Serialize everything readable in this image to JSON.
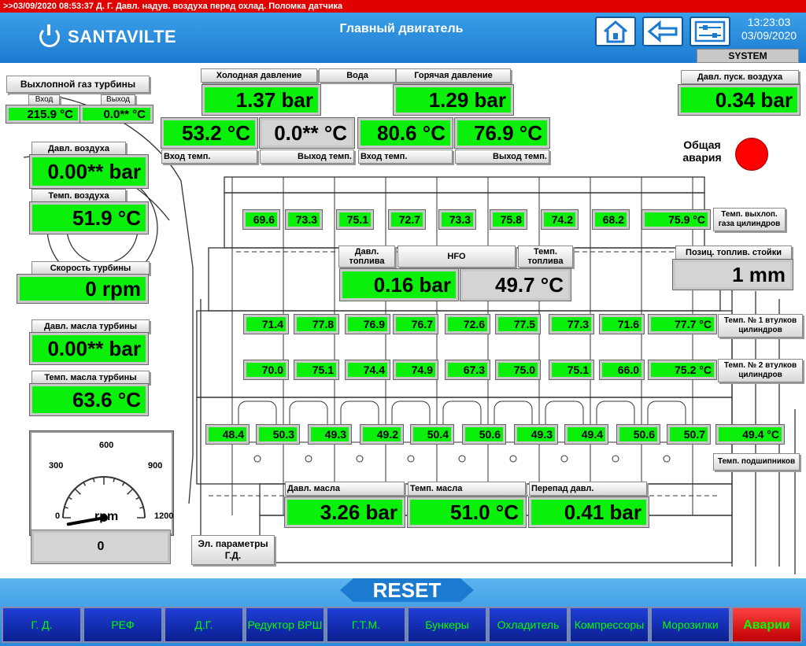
{
  "alarm_banner": ">>03/09/2020 08:53:37 Д. Г. Давл. надув. воздуха перед охлад. Поломка датчика",
  "header": {
    "logo": "SANTAVILTE",
    "title": "Главный двигатель",
    "time": "13:23:03",
    "date": "03/09/2020",
    "system_label": "SYSTEM"
  },
  "turbo_exhaust": {
    "title": "Выхлопной газ турбины",
    "in_label": "Вход",
    "out_label": "Выход",
    "in_value": "215.9 °C",
    "out_value": "0.0** °C"
  },
  "air_pressure": {
    "label": "Давл. воздуха",
    "value": "0.00** bar"
  },
  "air_temp": {
    "label": "Темп. воздуха",
    "value": "51.9 °C"
  },
  "turbo_speed": {
    "label": "Скорость турбины",
    "value": "0 rpm"
  },
  "turbo_oil_pressure": {
    "label": "Давл. масла турбины",
    "value": "0.00** bar"
  },
  "turbo_oil_temp": {
    "label": "Темп. масла турбины",
    "value": "63.6 °C"
  },
  "water": {
    "cold_label": "Холодная давление",
    "water_label": "Вода",
    "hot_label": "Горячая давление",
    "cold_pressure": "1.37 bar",
    "hot_pressure": "1.29 bar",
    "cold_in_temp": "53.2 °C",
    "cold_out_temp": "0.0** °C",
    "hot_in_temp": "80.6 °C",
    "hot_out_temp": "76.9 °C",
    "in_label": "Вход темп.",
    "out_label": "Выход темп."
  },
  "start_air": {
    "label": "Давл. пуск. воздуха",
    "value": "0.34 bar"
  },
  "general_alarm": {
    "label": "Общая авария",
    "color": "#ff0000"
  },
  "exhaust_cyl": {
    "label": "Темп. выхлоп. газа цилиндров",
    "values": [
      "69.6",
      "73.3",
      "75.1",
      "72.7",
      "73.3",
      "75.8",
      "74.2",
      "68.2",
      "75.9 °C"
    ]
  },
  "fuel": {
    "pressure_label": "Давл. топлива",
    "type_label": "HFO",
    "temp_label": "Темп. топлива",
    "pressure": "0.16 bar",
    "temp": "49.7 °C"
  },
  "rack": {
    "label": "Позиц. топлив. стойки",
    "value": "1 mm"
  },
  "liner1": {
    "label": "Темп. № 1 втулков цилиндров",
    "values": [
      "71.4",
      "77.8",
      "76.9",
      "76.7",
      "72.6",
      "77.5",
      "77.3",
      "71.6",
      "77.7 °C"
    ]
  },
  "liner2": {
    "label": "Темп. № 2 втулков цилиндров",
    "values": [
      "70.0",
      "75.1",
      "74.4",
      "74.9",
      "67.3",
      "75.0",
      "75.1",
      "66.0",
      "75.2 °C"
    ]
  },
  "bearings": {
    "label": "Темп. подшипников",
    "values": [
      "48.4",
      "50.3",
      "49.3",
      "49.2",
      "50.4",
      "50.6",
      "49.3",
      "49.4",
      "50.6",
      "50.7",
      "49.4 °C"
    ]
  },
  "oil": {
    "pressure_label": "Давл. масла",
    "temp_label": "Темп. масла",
    "diff_label": "Перепад давл.",
    "pressure": "3.26 bar",
    "temp": "51.0 °C",
    "diff": "0.41 bar"
  },
  "rpm_gauge": {
    "ticks": [
      "0",
      "300",
      "600",
      "900",
      "1200"
    ],
    "unit": "rpm",
    "value": 0,
    "display": "0",
    "max": 1200
  },
  "el_params": "Эл. параметры Г.Д.",
  "footer": {
    "reset": "RESET",
    "nav": [
      "Г. Д.",
      "РЕФ",
      "Д.Г.",
      "Редуктор ВРШ",
      "Г.Т.М.",
      "Бункеры",
      "Охладитель",
      "Компрессоры",
      "Морозилки",
      "Аварии"
    ]
  }
}
